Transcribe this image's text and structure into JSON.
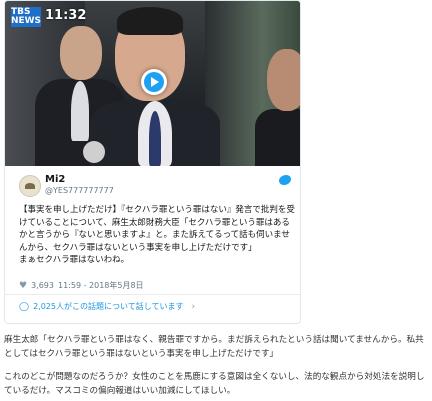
{
  "video": {
    "channel_logo": "TBS NEWS",
    "broadcast_time": "11:32",
    "play_icon": "play-icon"
  },
  "tweet": {
    "display_name": "Mi2",
    "handle": "@YES777777777",
    "text": "【事実を申し上げただけ】『セクハラ罪という罪はない』発言で批判を受けていることについて、麻生太郎財務大臣「セクハラ罪という罪はあるかと言うから『ないと思いますよ』と。また訴えてるって話も伺いませんから、セクハラ罪はないという事実を申し上げただけです」\nまぁセクハラ罪はないわね。",
    "likes": "3,693",
    "time": "11:59 - 2018年5月8日",
    "talk_link": "2,025人がこの話題について話しています",
    "icons": {
      "heart": "heart-icon",
      "comment": "comment-icon",
      "bird": "twitter-bird-icon",
      "arrow": "chevron-right-icon"
    },
    "accent_color": "#1da1f2"
  },
  "article": {
    "paragraph1": "麻生太郎「セクハラ罪という罪はなく、親告罪ですから。まだ訴えられたという話は聞いてませんから。私共としてはセクハラ罪という罪はないという事実を申し上げただけです」",
    "paragraph2": "これのどこが問題なのだろうか？女性のことを馬鹿にする意図は全くないし、法的な観点から対処法を説明しているだけ。マスコミの偏向報道はいい加減にしてほしい。"
  }
}
